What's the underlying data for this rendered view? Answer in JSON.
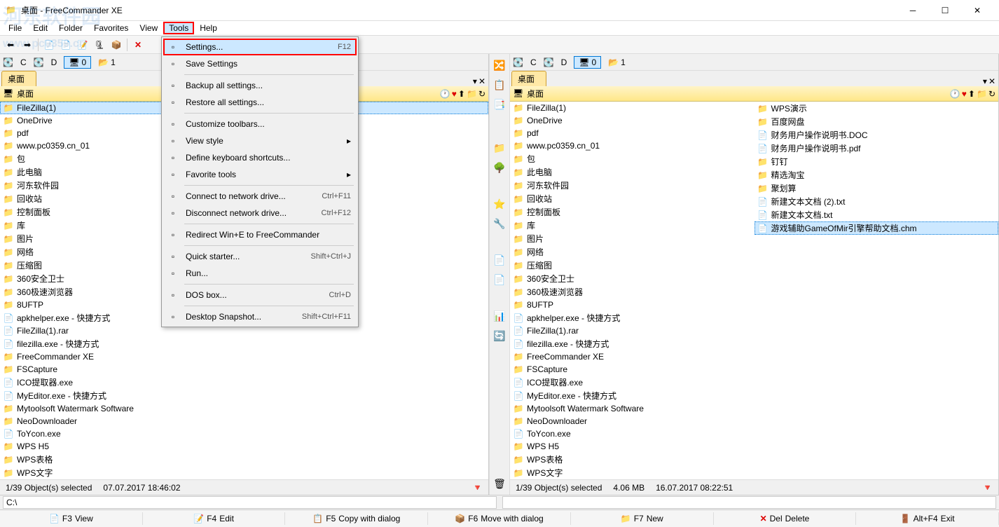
{
  "window": {
    "title": "桌面 - FreeCommander XE"
  },
  "menubar": [
    "File",
    "Edit",
    "Folder",
    "Favorites",
    "View",
    "Tools",
    "Help"
  ],
  "menubar_open": "Tools",
  "tools_menu": [
    {
      "label": "Settings...",
      "shortcut": "F12",
      "highlighted": true
    },
    {
      "label": "Save Settings",
      "shortcut": ""
    },
    {
      "sep": true
    },
    {
      "label": "Backup all settings...",
      "shortcut": ""
    },
    {
      "label": "Restore all settings...",
      "shortcut": ""
    },
    {
      "sep": true
    },
    {
      "label": "Customize toolbars...",
      "shortcut": ""
    },
    {
      "label": "View style",
      "shortcut": "",
      "submenu": true
    },
    {
      "label": "Define keyboard shortcuts...",
      "shortcut": ""
    },
    {
      "label": "Favorite tools",
      "shortcut": "",
      "submenu": true
    },
    {
      "sep": true
    },
    {
      "label": "Connect to network drive...",
      "shortcut": "Ctrl+F11"
    },
    {
      "label": "Disconnect network drive...",
      "shortcut": "Ctrl+F12"
    },
    {
      "sep": true
    },
    {
      "label": "Redirect Win+E to FreeCommander",
      "shortcut": ""
    },
    {
      "sep": true
    },
    {
      "label": "Quick starter...",
      "shortcut": "Shift+Ctrl+J"
    },
    {
      "label": "Run...",
      "shortcut": ""
    },
    {
      "sep": true
    },
    {
      "label": "DOS box...",
      "shortcut": "Ctrl+D"
    },
    {
      "sep": true
    },
    {
      "label": "Desktop Snapshot...",
      "shortcut": "Shift+Ctrl+F11"
    }
  ],
  "drivebar": {
    "c": "C",
    "d": "D",
    "active": "0",
    "extra": "1"
  },
  "left": {
    "tab": "桌面",
    "path": "桌面",
    "items": [
      "FileZilla(1)",
      "OneDrive",
      "pdf",
      "www.pc0359.cn_01",
      "包",
      "此电脑",
      "河东软件园",
      "回收站",
      "控制面板",
      "库",
      "图片",
      "网络",
      "压缩图",
      "360安全卫士",
      "360极速浏览器",
      "8UFTP",
      "apkhelper.exe - 快捷方式",
      "FileZilla(1).rar",
      "filezilla.exe - 快捷方式",
      "FreeCommander XE",
      "FSCapture",
      "ICO提取器.exe",
      "MyEditor.exe - 快捷方式",
      "Mytoolsoft Watermark Software",
      "NeoDownloader",
      "ToYcon.exe",
      "WPS H5",
      "WPS表格",
      "WPS文字"
    ],
    "selected": 0,
    "status": {
      "sel": "1/39 Object(s) selected",
      "date": "07.07.2017 18:46:02"
    }
  },
  "right": {
    "tab": "桌面",
    "path": "桌面",
    "items_col1": [
      "FileZilla(1)",
      "OneDrive",
      "pdf",
      "www.pc0359.cn_01",
      "包",
      "此电脑",
      "河东软件园",
      "回收站",
      "控制面板",
      "库",
      "图片",
      "网络",
      "压缩图",
      "360安全卫士",
      "360极速浏览器",
      "8UFTP",
      "apkhelper.exe - 快捷方式",
      "FileZilla(1).rar",
      "filezilla.exe - 快捷方式",
      "FreeCommander XE",
      "FSCapture",
      "ICO提取器.exe",
      "MyEditor.exe - 快捷方式",
      "Mytoolsoft Watermark Software",
      "NeoDownloader",
      "ToYcon.exe",
      "WPS H5",
      "WPS表格",
      "WPS文字"
    ],
    "items_col2": [
      "WPS演示",
      "百度网盘",
      "财务用户操作说明书.DOC",
      "财务用户操作说明书.pdf",
      "钉钉",
      "精选淘宝",
      "聚划算",
      "新建文本文档 (2).txt",
      "新建文本文档.txt",
      "游戏辅助GameOfMir引擎帮助文档.chm"
    ],
    "selected_col2": 9,
    "status": {
      "sel": "1/39 Object(s) selected",
      "size": "4.06 MB",
      "date": "16.07.2017 08:22:51"
    }
  },
  "pathline": "C:\\",
  "fnbar": [
    {
      "key": "F3",
      "label": "View"
    },
    {
      "key": "F4",
      "label": "Edit"
    },
    {
      "key": "F5",
      "label": "Copy with dialog"
    },
    {
      "key": "F6",
      "label": "Move with dialog"
    },
    {
      "key": "F7",
      "label": "New"
    },
    {
      "key": "Del",
      "label": "Delete"
    },
    {
      "key": "Alt+F4",
      "label": "Exit"
    }
  ],
  "watermark": "河东软件园\nwww.pc0359.cn"
}
